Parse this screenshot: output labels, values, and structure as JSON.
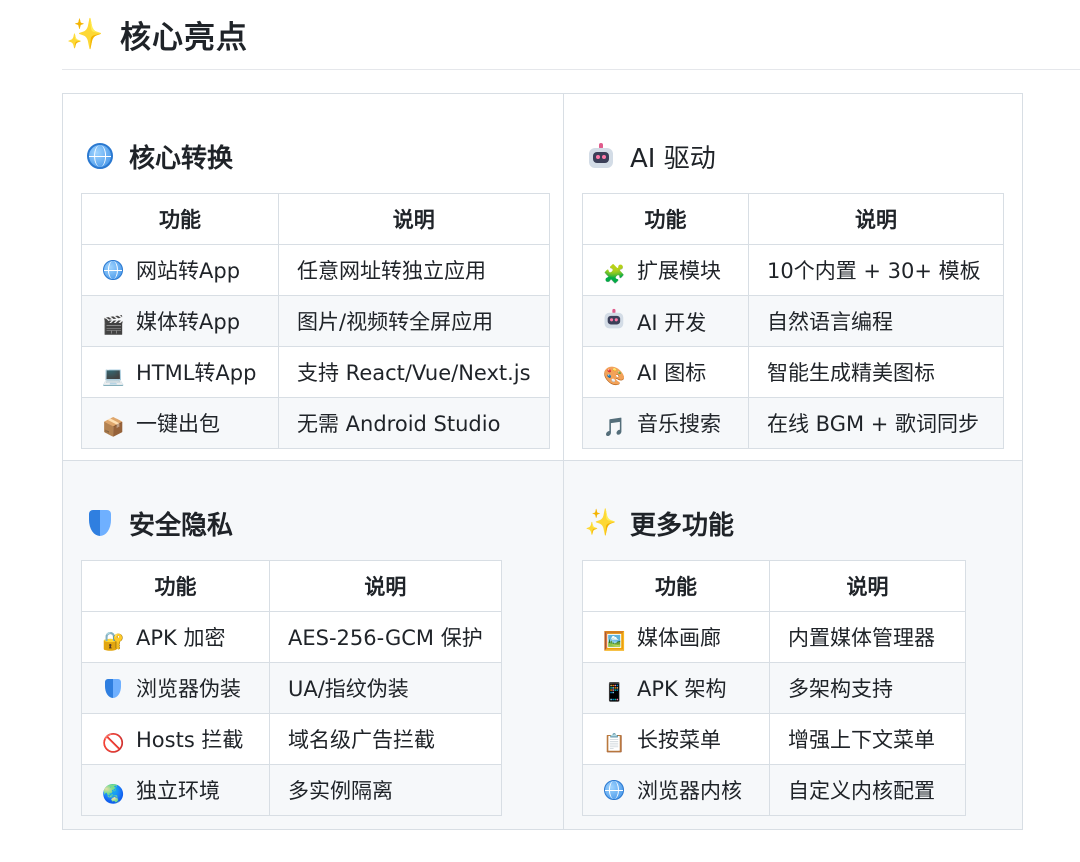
{
  "heading": {
    "emoji": "✨",
    "title": "核心亮点"
  },
  "columns": {
    "feature": "功能",
    "desc": "说明"
  },
  "sections": [
    {
      "title": "核心转换",
      "icon": "globe-icon",
      "rows": [
        {
          "icon": "globe-icon",
          "feature": "网站转App",
          "desc": "任意网址转独立应用"
        },
        {
          "icon": "🎬",
          "feature": "媒体转App",
          "desc": "图片/视频转全屏应用"
        },
        {
          "icon": "💻",
          "feature": "HTML转App",
          "desc": "支持 React/Vue/Next.js"
        },
        {
          "icon": "📦",
          "feature": "一键出包",
          "desc": "无需 Android Studio"
        }
      ]
    },
    {
      "title": "AI 驱动",
      "icon": "robot-icon",
      "rows": [
        {
          "icon": "🧩",
          "feature": "扩展模块",
          "desc": "10个内置 + 30+ 模板"
        },
        {
          "icon": "robot-icon",
          "feature": "AI 开发",
          "desc": "自然语言编程"
        },
        {
          "icon": "🎨",
          "feature": "AI 图标",
          "desc": "智能生成精美图标"
        },
        {
          "icon": "🎵",
          "feature": "音乐搜索",
          "desc": "在线 BGM + 歌词同步"
        }
      ]
    },
    {
      "title": "安全隐私",
      "icon": "shield-icon",
      "rows": [
        {
          "icon": "🔐",
          "feature": "APK 加密",
          "desc": "AES-256-GCM 保护"
        },
        {
          "icon": "shield-icon",
          "feature": "浏览器伪装",
          "desc": "UA/指纹伪装"
        },
        {
          "icon": "🚫",
          "feature": "Hosts 拦截",
          "desc": "域名级广告拦截"
        },
        {
          "icon": "🌏",
          "feature": "独立环境",
          "desc": "多实例隔离"
        }
      ]
    },
    {
      "title": "更多功能",
      "icon": "✨",
      "rows": [
        {
          "icon": "🖼️",
          "feature": "媒体画廊",
          "desc": "内置媒体管理器"
        },
        {
          "icon": "📱",
          "feature": "APK 架构",
          "desc": "多架构支持"
        },
        {
          "icon": "📋",
          "feature": "长按菜单",
          "desc": "增强上下文菜单"
        },
        {
          "icon": "globe-icon",
          "feature": "浏览器内核",
          "desc": "自定义内核配置"
        }
      ]
    }
  ]
}
